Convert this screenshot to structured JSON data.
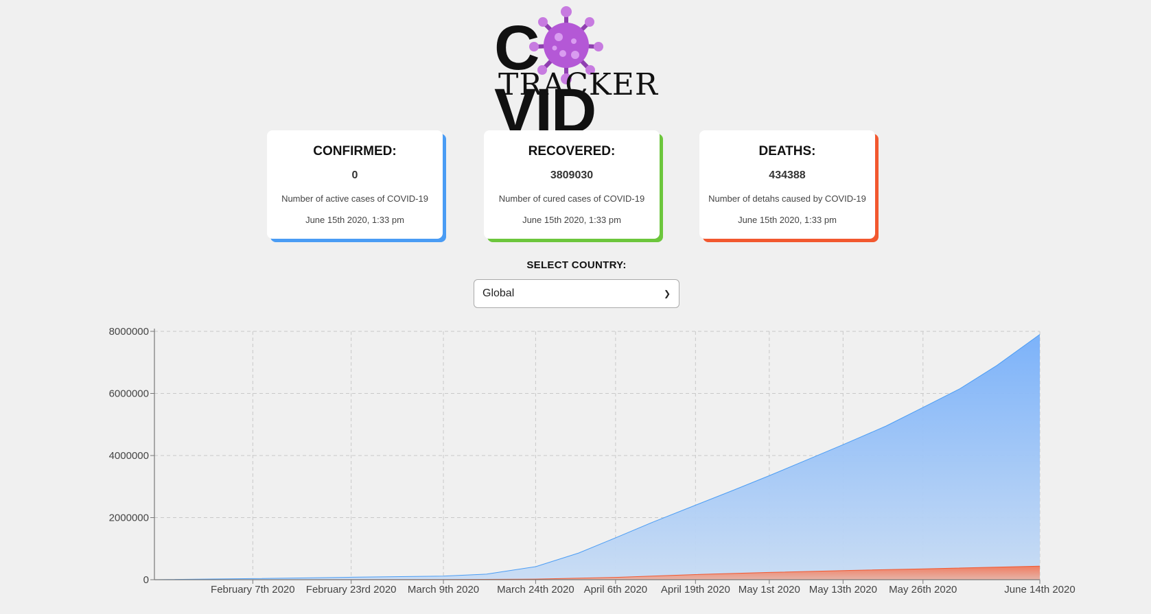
{
  "logo": {
    "word_left": "C",
    "word_right": "VID",
    "subtitle": "TRACKER"
  },
  "cards": [
    {
      "title": "CONFIRMED:",
      "value": "0",
      "description": "Number of active cases of COVID-19",
      "timestamp": "June 15th 2020, 1:33 pm",
      "color": "#4a9cf4"
    },
    {
      "title": "RECOVERED:",
      "value": "3809030",
      "description": "Number of cured cases of COVID-19",
      "timestamp": "June 15th 2020, 1:33 pm",
      "color": "#6cc63c"
    },
    {
      "title": "DEATHS:",
      "value": "434388",
      "description": "Number of detahs caused by COVID-19",
      "timestamp": "June 15th 2020, 1:33 pm",
      "color": "#f2582f"
    }
  ],
  "country_select": {
    "label": "SELECT COUNTRY:",
    "selected": "Global"
  },
  "chart_data": {
    "type": "area",
    "grid": true,
    "ylim": [
      0,
      8000000
    ],
    "y_ticks": [
      "0",
      "2000000",
      "4000000",
      "6000000",
      "8000000"
    ],
    "x_tick_labels": [
      "February 7th 2020",
      "February 23rd 2020",
      "March 9th 2020",
      "March 24th 2020",
      "April 6th 2020",
      "April 19th 2020",
      "May 1st 2020",
      "May 13th 2020",
      "May 26th 2020",
      "June 14th 2020"
    ],
    "x_tick_dates": [
      "2020-02-07",
      "2020-02-23",
      "2020-03-09",
      "2020-03-24",
      "2020-04-06",
      "2020-04-19",
      "2020-05-01",
      "2020-05-13",
      "2020-05-26",
      "2020-06-14"
    ],
    "xlim": [
      "2020-01-22",
      "2020-06-14"
    ],
    "series": [
      {
        "color": "#4a9cf4",
        "points": [
          [
            "2020-01-22",
            555
          ],
          [
            "2020-02-07",
            35000
          ],
          [
            "2020-02-23",
            79000
          ],
          [
            "2020-03-09",
            114000
          ],
          [
            "2020-03-16",
            180000
          ],
          [
            "2020-03-24",
            420000
          ],
          [
            "2020-03-31",
            860000
          ],
          [
            "2020-04-06",
            1350000
          ],
          [
            "2020-04-12",
            1850000
          ],
          [
            "2020-04-19",
            2400000
          ],
          [
            "2020-04-25",
            2870000
          ],
          [
            "2020-05-01",
            3350000
          ],
          [
            "2020-05-07",
            3850000
          ],
          [
            "2020-05-13",
            4350000
          ],
          [
            "2020-05-20",
            4950000
          ],
          [
            "2020-05-26",
            5550000
          ],
          [
            "2020-06-01",
            6150000
          ],
          [
            "2020-06-07",
            6900000
          ],
          [
            "2020-06-14",
            7900000
          ]
        ]
      },
      {
        "color": "#f2582f",
        "points": [
          [
            "2020-01-22",
            17
          ],
          [
            "2020-02-07",
            700
          ],
          [
            "2020-02-23",
            2500
          ],
          [
            "2020-03-09",
            4000
          ],
          [
            "2020-03-24",
            19000
          ],
          [
            "2020-04-06",
            75000
          ],
          [
            "2020-04-19",
            165000
          ],
          [
            "2020-05-01",
            235000
          ],
          [
            "2020-05-13",
            295000
          ],
          [
            "2020-05-26",
            350000
          ],
          [
            "2020-06-14",
            434388
          ]
        ]
      }
    ]
  }
}
